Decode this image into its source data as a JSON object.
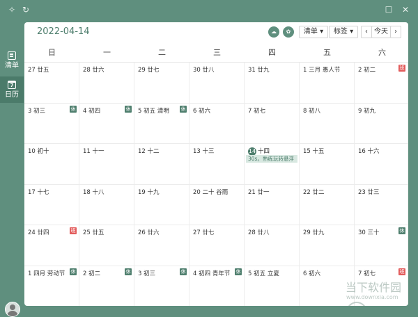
{
  "titlebar": {
    "pin_icon": "pin-icon",
    "sync_icon": "sync-icon",
    "maximize_icon": "maximize-icon",
    "close_icon": "close-icon"
  },
  "sidebar": {
    "items": [
      {
        "label": "清单",
        "icon": "list-icon"
      },
      {
        "label": "日历",
        "icon": "calendar-icon",
        "icon_text": "7"
      }
    ]
  },
  "header": {
    "date": "2022-04-14",
    "list_button": "清单 ▾",
    "tag_button": "标签 ▾",
    "prev": "‹",
    "today": "今天",
    "next": "›"
  },
  "weekdays": [
    "日",
    "一",
    "二",
    "三",
    "四",
    "五",
    "六"
  ],
  "weeks": [
    [
      {
        "d": "27",
        "l": "廿五"
      },
      {
        "d": "28",
        "l": "廿六"
      },
      {
        "d": "29",
        "l": "廿七"
      },
      {
        "d": "30",
        "l": "廿八"
      },
      {
        "d": "31",
        "l": "廿九"
      },
      {
        "d": "1",
        "l": "三月 愚人节"
      },
      {
        "d": "2",
        "l": "初二",
        "badge": "班",
        "type": "work"
      }
    ],
    [
      {
        "d": "3",
        "l": "初三",
        "badge": "休",
        "type": "rest"
      },
      {
        "d": "4",
        "l": "初四",
        "badge": "休",
        "type": "rest"
      },
      {
        "d": "5",
        "l": "初五 清明",
        "badge": "休",
        "type": "rest"
      },
      {
        "d": "6",
        "l": "初六"
      },
      {
        "d": "7",
        "l": "初七"
      },
      {
        "d": "8",
        "l": "初八"
      },
      {
        "d": "9",
        "l": "初九"
      }
    ],
    [
      {
        "d": "10",
        "l": "初十"
      },
      {
        "d": "11",
        "l": "十一"
      },
      {
        "d": "12",
        "l": "十二"
      },
      {
        "d": "13",
        "l": "十三"
      },
      {
        "d": "14",
        "l": "十四",
        "today": true,
        "event": "30s。熟练玩转悬浮"
      },
      {
        "d": "15",
        "l": "十五"
      },
      {
        "d": "16",
        "l": "十六"
      }
    ],
    [
      {
        "d": "17",
        "l": "十七"
      },
      {
        "d": "18",
        "l": "十八"
      },
      {
        "d": "19",
        "l": "十九"
      },
      {
        "d": "20",
        "l": "二十 谷雨"
      },
      {
        "d": "21",
        "l": "廿一"
      },
      {
        "d": "22",
        "l": "廿二"
      },
      {
        "d": "23",
        "l": "廿三"
      }
    ],
    [
      {
        "d": "24",
        "l": "廿四",
        "badge": "班",
        "type": "work"
      },
      {
        "d": "25",
        "l": "廿五"
      },
      {
        "d": "26",
        "l": "廿六"
      },
      {
        "d": "27",
        "l": "廿七"
      },
      {
        "d": "28",
        "l": "廿八"
      },
      {
        "d": "29",
        "l": "廿九"
      },
      {
        "d": "30",
        "l": "三十",
        "badge": "休",
        "type": "rest"
      }
    ],
    [
      {
        "d": "1",
        "l": "四月 劳动节",
        "badge": "休",
        "type": "rest"
      },
      {
        "d": "2",
        "l": "初二",
        "badge": "休",
        "type": "rest"
      },
      {
        "d": "3",
        "l": "初三",
        "badge": "休",
        "type": "rest"
      },
      {
        "d": "4",
        "l": "初四 青年节",
        "badge": "休",
        "type": "rest"
      },
      {
        "d": "5",
        "l": "初五 立夏"
      },
      {
        "d": "6",
        "l": "初六"
      },
      {
        "d": "7",
        "l": "初七",
        "badge": "班",
        "type": "work"
      }
    ]
  ],
  "watermark": {
    "text": "当下软件园",
    "sub": "www.downxia.com"
  }
}
